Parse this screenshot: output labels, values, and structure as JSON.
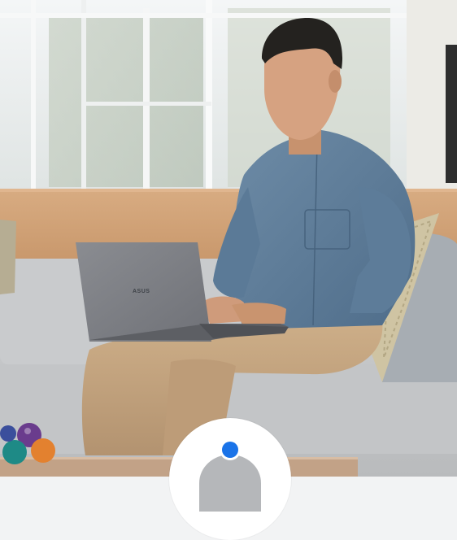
{
  "scene": {
    "laptop_logo_text": "ASUS",
    "colors": {
      "wall": "#e9e7e2",
      "wood_panel": "#d3a57b",
      "sofa": "#c4c6c7",
      "shirt": "#5a7996",
      "pants": "#c2a27c",
      "laptop": "#7e8086",
      "badge_accent": "#1a73e8"
    }
  },
  "avatar": {
    "icon": "user-avatar-icon"
  }
}
